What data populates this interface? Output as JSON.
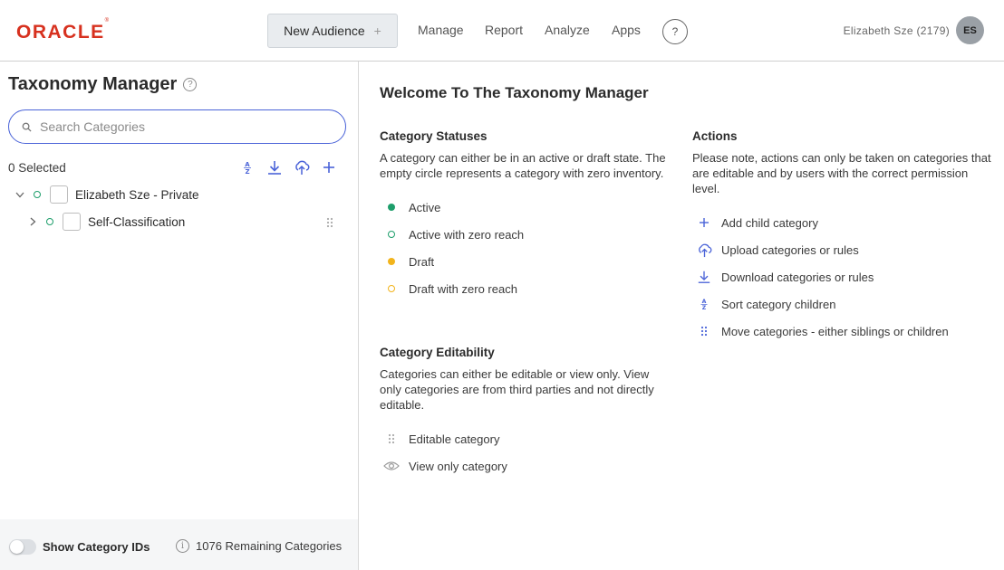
{
  "header": {
    "logo": "ORACLE",
    "new_audience": "New Audience",
    "new_audience_plus": "+",
    "nav": [
      "Manage",
      "Report",
      "Analyze",
      "Apps"
    ],
    "help": "?",
    "user": "Elizabeth Sze (2179)",
    "avatar": "ES"
  },
  "sidebar": {
    "title": "Taxonomy Manager",
    "search_placeholder": "Search Categories",
    "selected": "0 Selected",
    "tree": [
      {
        "label": "Elizabeth Sze - Private",
        "expanded": true
      },
      {
        "label": "Self-Classification",
        "expanded": false
      }
    ],
    "footer": {
      "show_ids": "Show Category IDs",
      "remaining": "1076 Remaining Categories"
    }
  },
  "main": {
    "welcome": "Welcome To The Taxonomy Manager",
    "statuses": {
      "title": "Category Statuses",
      "desc": "A category can either be in an active or draft state. The empty circle represents a category with zero inventory.",
      "items": [
        "Active",
        "Active with zero reach",
        "Draft",
        "Draft with zero reach"
      ]
    },
    "editability": {
      "title": "Category Editability",
      "desc": "Categories can either be editable or view only. View only categories are from third parties and not directly editable.",
      "items": [
        "Editable category",
        "View only category"
      ]
    },
    "actions": {
      "title": "Actions",
      "desc": "Please note, actions can only be taken on categories that are editable and by users with the correct permission level.",
      "items": [
        "Add child category",
        "Upload categories or rules",
        "Download categories or rules",
        "Sort category children",
        "Move categories - either siblings or children"
      ]
    }
  },
  "colors": {
    "active": "#1e9e6b",
    "draft": "#f2b41c",
    "accent": "#4a63d8",
    "brand": "#d7311f"
  }
}
